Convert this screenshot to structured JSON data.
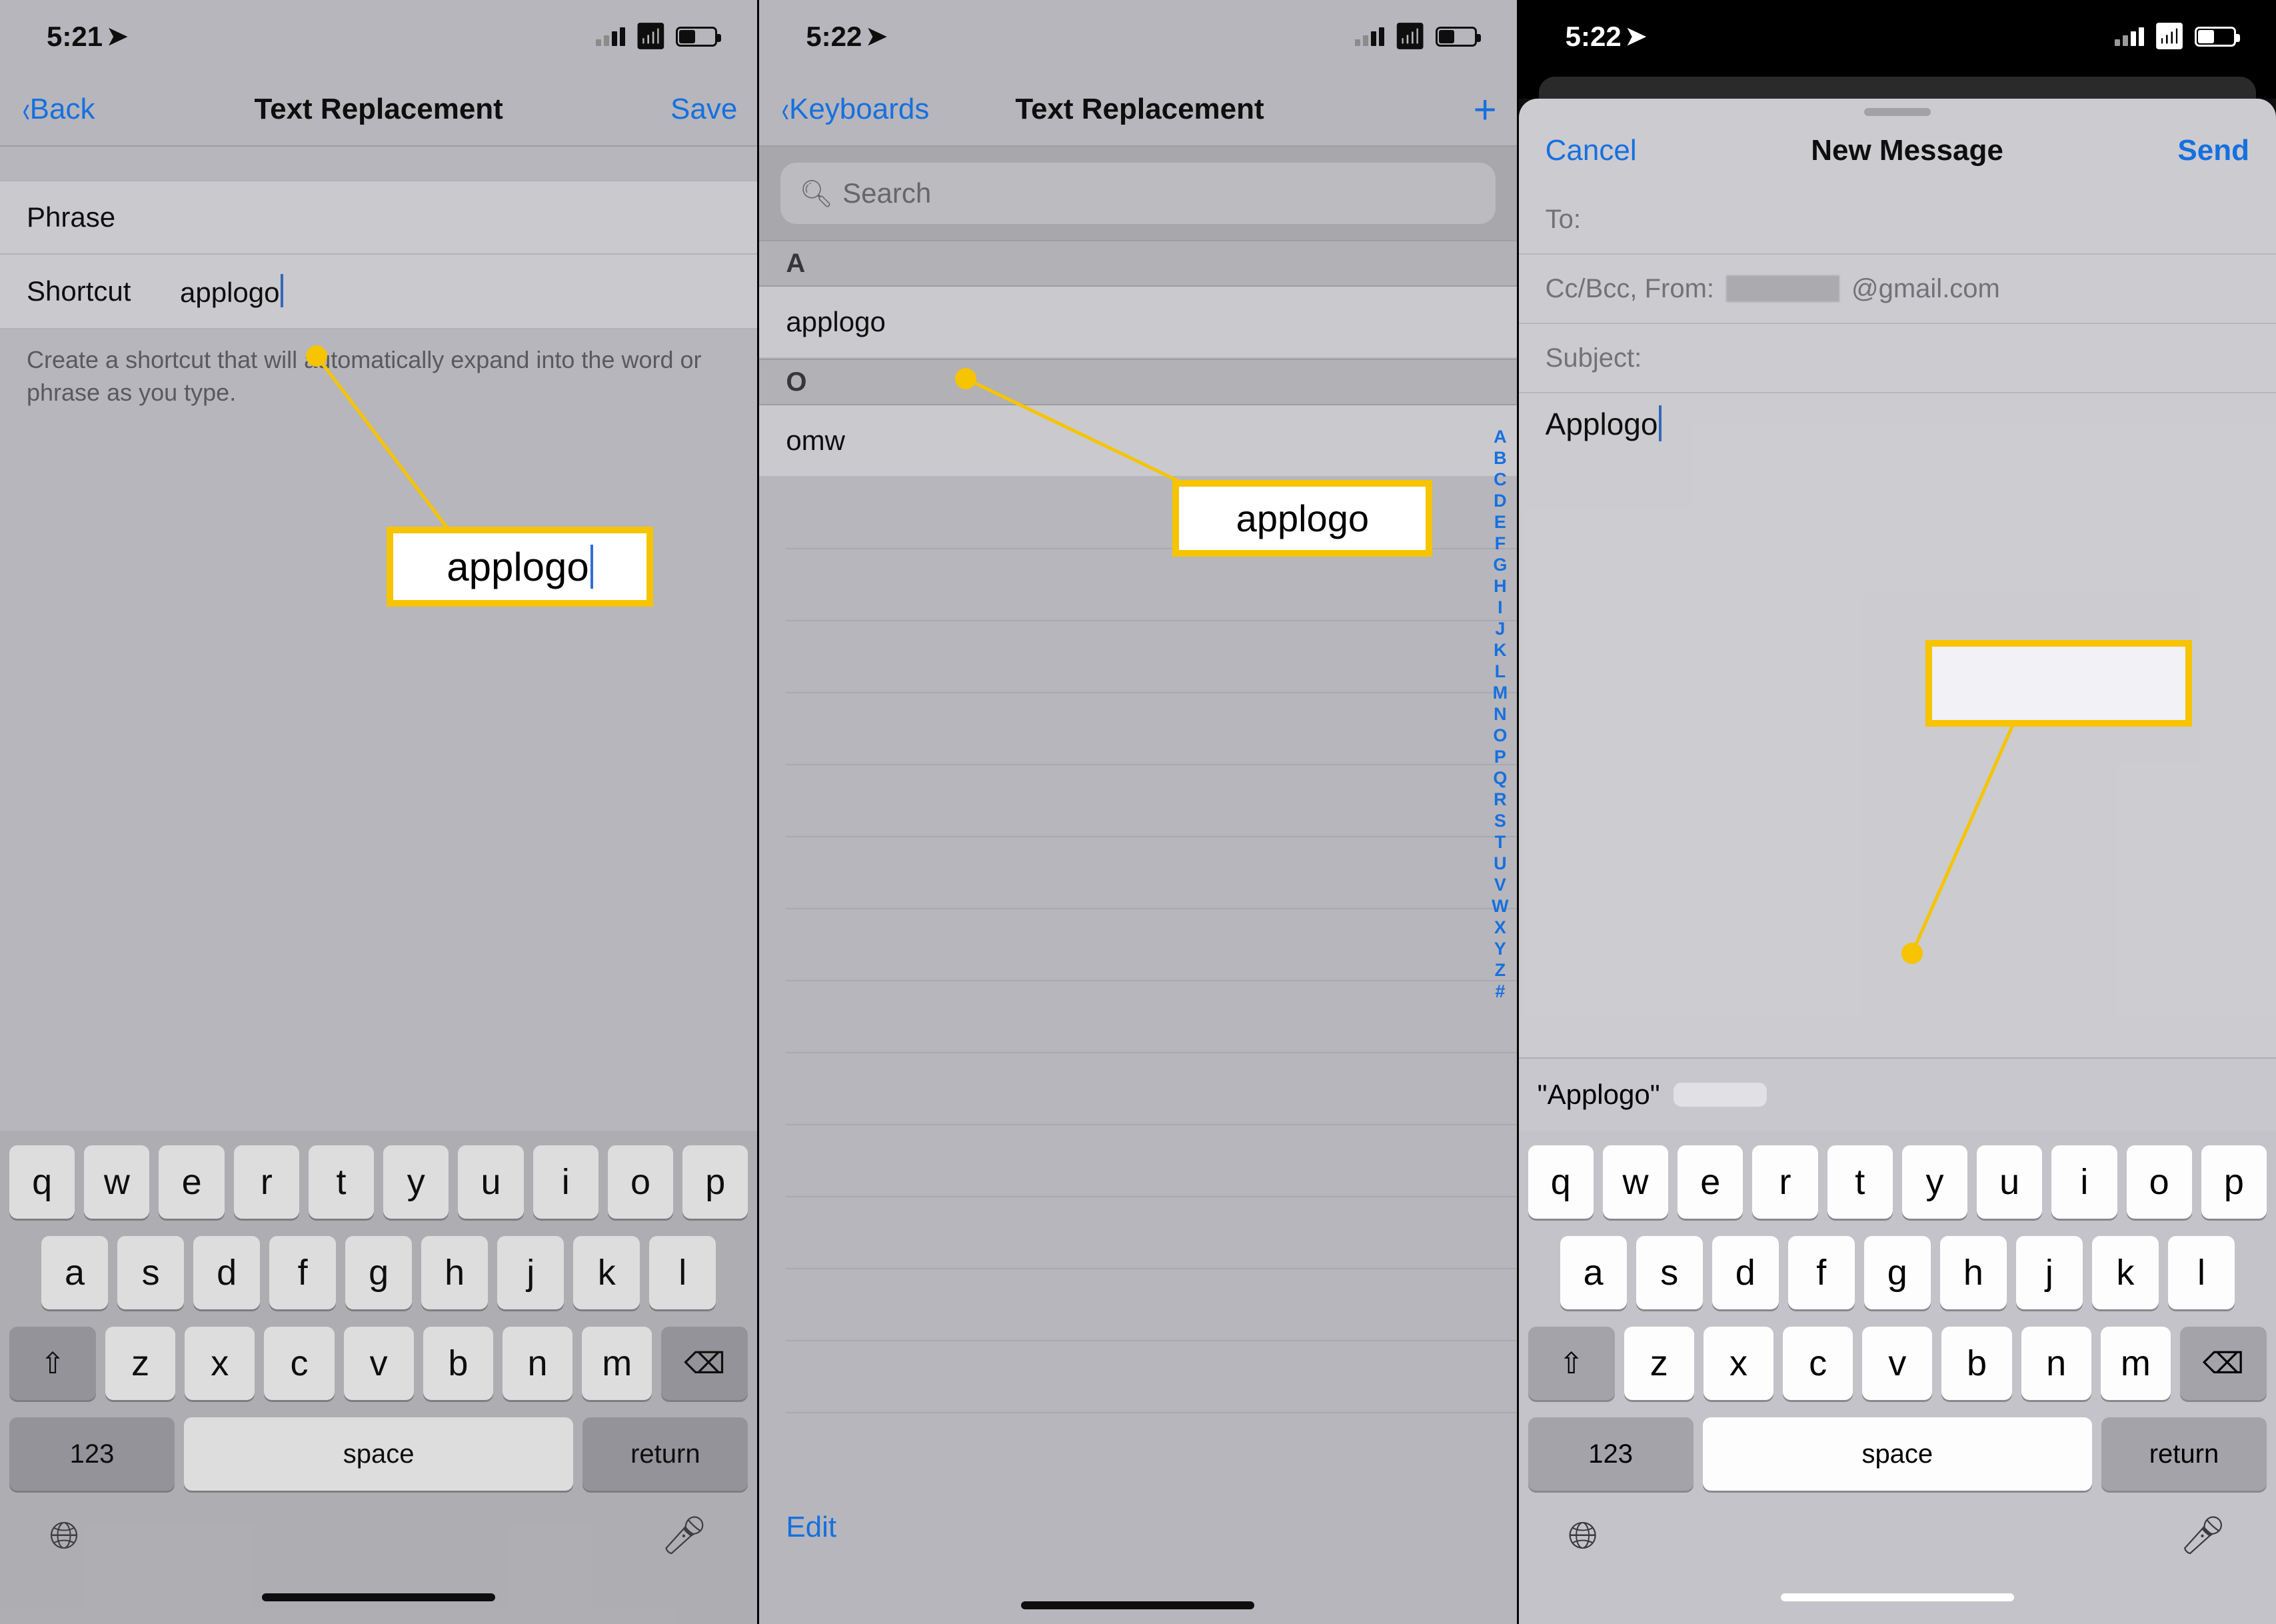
{
  "panel1": {
    "status_time": "5:21",
    "nav_back": "Back",
    "nav_title": "Text Replacement",
    "nav_save": "Save",
    "phrase_label": "Phrase",
    "phrase_value": "",
    "shortcut_label": "Shortcut",
    "shortcut_value": "applogo",
    "helper_text": "Create a shortcut that will automatically expand into the word or phrase as you type.",
    "callout_text": "applogo"
  },
  "panel2": {
    "status_time": "5:22",
    "nav_back": "Keyboards",
    "nav_title": "Text Replacement",
    "search_placeholder": "Search",
    "section_a": "A",
    "item_a_name": "applogo",
    "item_a_value": "",
    "section_o": "O",
    "item_o_name": "omw",
    "index_rail": [
      "A",
      "B",
      "C",
      "D",
      "E",
      "F",
      "G",
      "H",
      "I",
      "J",
      "K",
      "L",
      "M",
      "N",
      "O",
      "P",
      "Q",
      "R",
      "S",
      "T",
      "U",
      "V",
      "W",
      "X",
      "Y",
      "Z",
      "#"
    ],
    "edit_label": "Edit",
    "callout_text": "applogo"
  },
  "panel3": {
    "status_time": "5:22",
    "sheet_cancel": "Cancel",
    "sheet_title": "New Message",
    "sheet_send": "Send",
    "to_label": "To:",
    "ccbcc_label": "Cc/Bcc, From:",
    "ccbcc_value": "@gmail.com",
    "subject_label": "Subject:",
    "body_value": "Applogo",
    "pred_word": "\"Applogo\"",
    "pred_chip": "",
    "callout_glyph": ""
  },
  "keyboard": {
    "row1": [
      "q",
      "w",
      "e",
      "r",
      "t",
      "y",
      "u",
      "i",
      "o",
      "p"
    ],
    "row2": [
      "a",
      "s",
      "d",
      "f",
      "g",
      "h",
      "j",
      "k",
      "l"
    ],
    "row3": [
      "z",
      "x",
      "c",
      "v",
      "b",
      "n",
      "m"
    ],
    "k123": "123",
    "space": "space",
    "return": "return"
  }
}
